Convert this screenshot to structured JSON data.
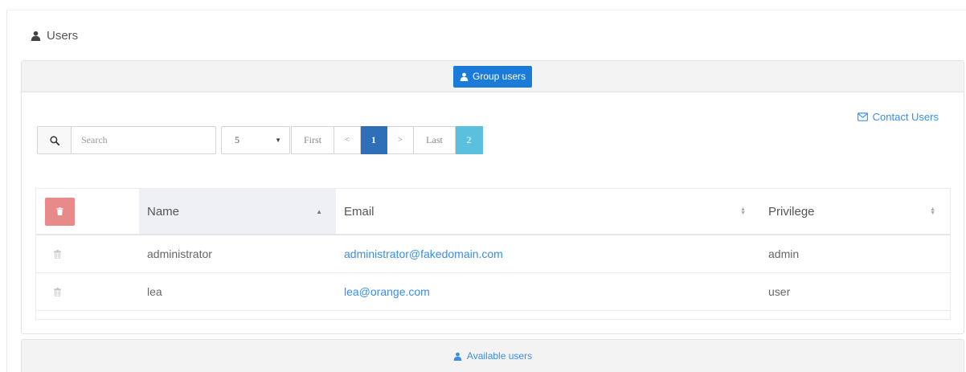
{
  "page": {
    "section_title": "Users",
    "section_icon": "user-icon"
  },
  "group_panel": {
    "header_label": "Group users",
    "header_icon": "user-icon",
    "contact_label": "Contact Users",
    "contact_icon": "envelope-icon"
  },
  "toolbar": {
    "search_placeholder": "Search",
    "search_value": "",
    "search_icon": "search-icon",
    "page_size_value": "5",
    "pager": {
      "first_label": "First",
      "prev_label": "<",
      "current_page": "1",
      "next_label": ">",
      "last_label": "Last",
      "total_pages": "2"
    }
  },
  "table": {
    "columns": {
      "name": "Name",
      "email": "Email",
      "privilege": "Privilege"
    },
    "sort": {
      "column": "name",
      "direction": "asc"
    },
    "rows": [
      {
        "name": "administrator",
        "email": "administrator@fakedomain.com",
        "privilege": "admin"
      },
      {
        "name": "lea",
        "email": "lea@orange.com",
        "privilege": "user"
      }
    ]
  },
  "available_panel": {
    "header_label": "Available users",
    "header_icon": "user-icon"
  },
  "colors": {
    "primary": "#1a7bd9",
    "link": "#3a8ee6",
    "pager_active": "#2e6fb7",
    "pager_total": "#5bc0de",
    "danger": "#e8898a"
  }
}
